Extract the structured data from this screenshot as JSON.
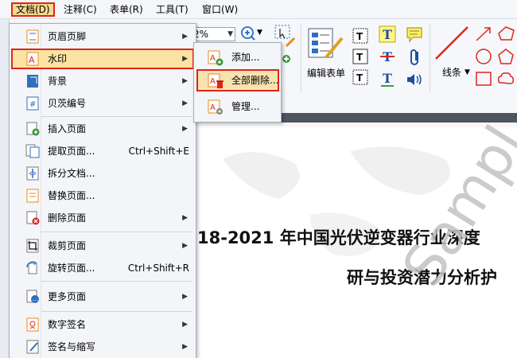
{
  "menubar": {
    "items": [
      {
        "label": "文档(D)",
        "active": true
      },
      {
        "label": "注释(C)"
      },
      {
        "label": "表单(R)"
      },
      {
        "label": "工具(T)"
      },
      {
        "label": "窗口(W)"
      }
    ]
  },
  "toolbar": {
    "zoom_value": "2%",
    "edit_form_label": "编辑表单",
    "line_label": "线条"
  },
  "document": {
    "title_line1": "18-2021 年中国光伏逆变器行业深度",
    "title_line2": "研与投资潜力分析护",
    "watermark": "Sampl"
  },
  "doc_menu": {
    "items": [
      {
        "label": "页眉页脚",
        "icon": "header-footer-icon",
        "submenu": true
      },
      {
        "label": "水印",
        "icon": "watermark-icon",
        "submenu": true,
        "highlighted": true
      },
      {
        "label": "背景",
        "icon": "background-icon",
        "submenu": true
      },
      {
        "label": "贝茨编号",
        "icon": "bates-numbering-icon",
        "submenu": true
      },
      {
        "label": "插入页面",
        "icon": "insert-page-icon",
        "submenu": true
      },
      {
        "label": "提取页面...",
        "icon": "extract-page-icon",
        "shortcut": "Ctrl+Shift+E"
      },
      {
        "label": "拆分文档...",
        "icon": "split-document-icon"
      },
      {
        "label": "替换页面...",
        "icon": "replace-page-icon"
      },
      {
        "label": "删除页面",
        "icon": "delete-page-icon",
        "submenu": true
      },
      {
        "label": "裁剪页面",
        "icon": "crop-page-icon",
        "submenu": true
      },
      {
        "label": "旋转页面...",
        "icon": "rotate-page-icon",
        "shortcut": "Ctrl+Shift+R"
      },
      {
        "label": "更多页面",
        "icon": "more-pages-icon",
        "submenu": true
      },
      {
        "label": "数字签名",
        "icon": "digital-signature-icon",
        "submenu": true
      },
      {
        "label": "签名与缩写",
        "icon": "sign-initials-icon",
        "submenu": true
      }
    ]
  },
  "watermark_submenu": {
    "items": [
      {
        "label": "添加...",
        "icon": "add-watermark-icon"
      },
      {
        "label": "全部删除...",
        "icon": "delete-all-watermark-icon",
        "highlighted": true
      },
      {
        "label": "管理...",
        "icon": "manage-watermark-icon"
      }
    ]
  },
  "colors": {
    "highlight_border": "#e0251b",
    "highlight_fill": "#fbe3a3",
    "menu_bg": "#f3f5f9"
  }
}
